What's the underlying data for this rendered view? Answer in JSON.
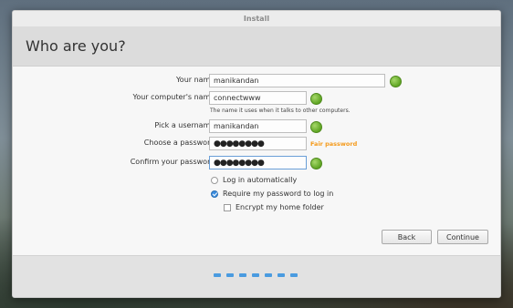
{
  "window": {
    "title": "Install"
  },
  "header": {
    "title": "Who are you?"
  },
  "form": {
    "name": {
      "label": "Your name:",
      "value": "manikandan"
    },
    "computer": {
      "label": "Your computer's name:",
      "value": "connectwww",
      "hint": "The name it uses when it talks to other computers."
    },
    "username": {
      "label": "Pick a username:",
      "value": "manikandan"
    },
    "password": {
      "label": "Choose a password:",
      "value": "●●●●●●●●",
      "strength": "Fair password"
    },
    "confirm": {
      "label": "Confirm your password:",
      "value": "●●●●●●●●"
    }
  },
  "options": {
    "auto_login": {
      "label": "Log in automatically",
      "checked": false
    },
    "require_password": {
      "label": "Require my password to log in",
      "checked": true
    },
    "encrypt_home": {
      "label": "Encrypt my home folder",
      "checked": false
    }
  },
  "buttons": {
    "back": "Back",
    "continue": "Continue"
  },
  "progress": {
    "steps_total": 7,
    "current_step": 7
  },
  "colors": {
    "ok": "#5fa523",
    "accent": "#4a9be0",
    "fair": "#f59a1a"
  }
}
